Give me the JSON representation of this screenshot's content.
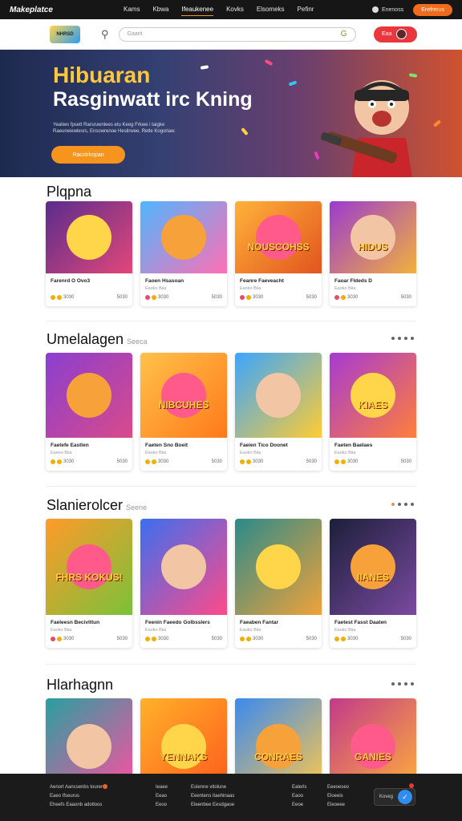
{
  "topnav": {
    "brand": "Makeplatce",
    "links": [
      "Kams",
      "Kbwa",
      "Ifeaukenee",
      "Kovks",
      "Elsomeks",
      "Pefinr"
    ],
    "active_index": 2,
    "user_label": "Enenoss",
    "cta_label": "Erefrerus"
  },
  "subbar": {
    "logo_text": "NHRSD",
    "search_placeholder": "Gaarit",
    "search_suffix_icon": "g-glyph-icon",
    "login_label": "Eaa"
  },
  "hero": {
    "title": "Hibuaran",
    "subtitle": "Rasginwatt irc Kning",
    "description": "Yealiws fpsett Rarsruwnlees etu Keeg Frkwe i taigke Raeuneiewlesrs, Ensowrenoe Heslirwee, Retle Kogorlaw.",
    "button_label": "Racidrkopan"
  },
  "sections": [
    {
      "title": "Plqpna",
      "subtitle": "",
      "dots": 0,
      "cards": [
        {
          "title": "Farenrd O Ovo3",
          "sub": "",
          "price": "3030",
          "right": "5030",
          "coin": "gold",
          "word": ""
        },
        {
          "title": "Faoen Hsasoan",
          "sub": "Eaoko Biia",
          "price": "3030",
          "right": "5030",
          "coin": "pink",
          "word": ""
        },
        {
          "title": "Feanre Faeveacht",
          "sub": "Eaoko Biia",
          "price": "3030",
          "right": "5030",
          "coin": "pink",
          "word": "NOUSCOHSS"
        },
        {
          "title": "Faoar Fldeds D",
          "sub": "Eaoko Biia",
          "price": "3030",
          "right": "5030",
          "coin": "pink",
          "word": "HIDUS"
        }
      ]
    },
    {
      "title": "Umelalagen",
      "subtitle": "Seeca",
      "dots": 4,
      "cards": [
        {
          "title": "Faetefe Eastlen",
          "sub": "Eaeeo Biia",
          "price": "3030",
          "right": "5030",
          "coin": "gold",
          "word": ""
        },
        {
          "title": "Faeten Sno Boeit",
          "sub": "Eaoko Biia",
          "price": "3030",
          "right": "5030",
          "coin": "gold",
          "word": "NIBCUHES"
        },
        {
          "title": "Faeien Tico Doonet",
          "sub": "Eaoko Biia",
          "price": "3030",
          "right": "5030",
          "coin": "gold",
          "word": ""
        },
        {
          "title": "Faeten Baelaes",
          "sub": "Eaoko Biia",
          "price": "3030",
          "right": "5030",
          "coin": "gold",
          "word": "KIAES"
        }
      ]
    },
    {
      "title": "Slanierolcer",
      "subtitle": "Seene",
      "dots": 4,
      "cards": [
        {
          "title": "Faeleesn Becivittun",
          "sub": "Eaoko Biia",
          "price": "3030",
          "right": "5030",
          "coin": "pink",
          "word": "FHRS KOKUS!"
        },
        {
          "title": "Feenin Faeedo Golbsslers",
          "sub": "Eaoko Biia",
          "price": "3030",
          "right": "5030",
          "coin": "gold",
          "word": ""
        },
        {
          "title": "Faeaben Fantar",
          "sub": "Eaoko Biia",
          "price": "3030",
          "right": "5030",
          "coin": "gold",
          "word": ""
        },
        {
          "title": "Faetest Fasst Daaten",
          "sub": "Eaoko Biia",
          "price": "3030",
          "right": "5030",
          "coin": "gold",
          "word": "IIANES"
        }
      ]
    },
    {
      "title": "Hlarhagnn",
      "subtitle": "",
      "dots": 4,
      "cards": [
        {
          "title": "",
          "sub": "",
          "price": "",
          "right": "",
          "coin": "gold",
          "word": ""
        },
        {
          "title": "",
          "sub": "",
          "price": "",
          "right": "",
          "coin": "gold",
          "word": "YENNAKS"
        },
        {
          "title": "",
          "sub": "",
          "price": "",
          "right": "",
          "coin": "gold",
          "word": "CONRAES"
        },
        {
          "title": "",
          "sub": "",
          "price": "",
          "right": "",
          "coin": "gold",
          "word": "GANIES"
        }
      ]
    }
  ],
  "footer": {
    "col1": [
      "Aenort Aancsenbs tourer",
      "Eaeo Ifseurus",
      "Eheefs Eaaonb adotloos"
    ],
    "col2": [
      "Ieaee",
      "Eeao",
      "Eeoo"
    ],
    "col3": [
      "Eslenne vitolune",
      "Eeentens itaehinaas",
      "Eleenbee Eesdgaoe"
    ],
    "col4": [
      "Ealerls",
      "Eaoo",
      "Eeoe"
    ],
    "col5": [
      "Eeeoeseo",
      "Eloeeis",
      "Eleoeee"
    ],
    "chat_label": "Koveg"
  },
  "colors": {
    "accent": "#f26a1b",
    "login": "#e8383d",
    "hero_title": "#ffc83a",
    "hero_button": "#f7941d"
  }
}
